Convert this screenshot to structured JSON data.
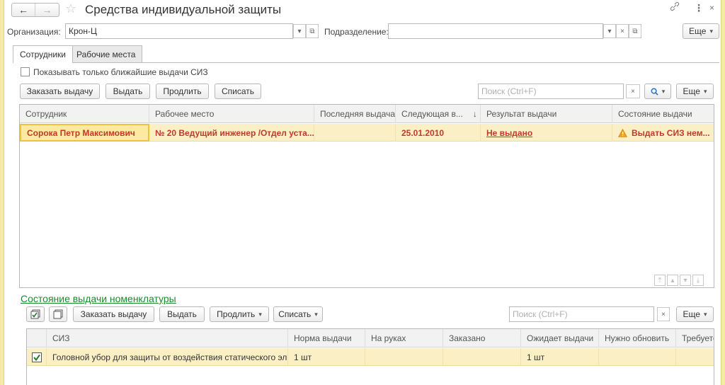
{
  "window": {
    "title": "Средства индивидуальной защиты",
    "back_icon": "arrow-left-icon",
    "forward_icon": "arrow-right-icon",
    "favorite_icon": "star-icon",
    "link_icon": "link-icon",
    "menu_icon": "more-vertical-icon",
    "close_icon": "close-icon"
  },
  "filters": {
    "org_label": "Организация:",
    "org_value": "Крон-Ц",
    "dept_label": "Подразделение:",
    "dept_value": "",
    "more_label": "Еще"
  },
  "tabs": [
    {
      "label": "Сотрудники",
      "active": true
    },
    {
      "label": "Рабочие места",
      "active": false
    }
  ],
  "employees": {
    "show_nearest_label": "Показывать только ближайшие выдачи СИЗ",
    "toolbar": {
      "order": "Заказать выдачу",
      "issue": "Выдать",
      "extend": "Продлить",
      "write_off": "Списать",
      "more": "Еще"
    },
    "search_placeholder": "Поиск (Ctrl+F)",
    "columns": [
      "Сотрудник",
      "Рабочее место",
      "Последняя выдача",
      "Следующая в...",
      "Результат выдачи",
      "Состояние выдачи"
    ],
    "sort_indicator": "↓",
    "rows": [
      {
        "employee": "Сорока Петр Максимович",
        "workplace": "№ 20 Ведущий инженер /Отдел уста...",
        "last_issue": "",
        "next_issue": "25.01.2010",
        "result": "Не выдано",
        "status": "Выдать СИЗ нем..."
      }
    ]
  },
  "nomenclature": {
    "section_title": "Состояние выдачи номенклатуры",
    "toolbar": {
      "order": "Заказать выдачу",
      "issue": "Выдать",
      "extend": "Продлить",
      "write_off": "Списать",
      "more": "Еще"
    },
    "search_placeholder": "Поиск (Ctrl+F)",
    "columns": [
      "СИЗ",
      "Норма выдачи",
      "На руках",
      "Заказано",
      "Ожидает выдачи",
      "Нужно обновить",
      "Требуется"
    ],
    "rows": [
      {
        "checked": true,
        "item": "Головной убор для защиты от воздействия статического эл...",
        "norm": "1 шт",
        "on_hand": "",
        "ordered": "",
        "awaiting": "1 шт",
        "to_update": "",
        "required": ""
      }
    ]
  },
  "colors": {
    "accent_red": "#c0392b",
    "section_green": "#1a8a2b",
    "row_highlight": "#fbf0c5",
    "frame_yellow": "#f5e9a6"
  }
}
